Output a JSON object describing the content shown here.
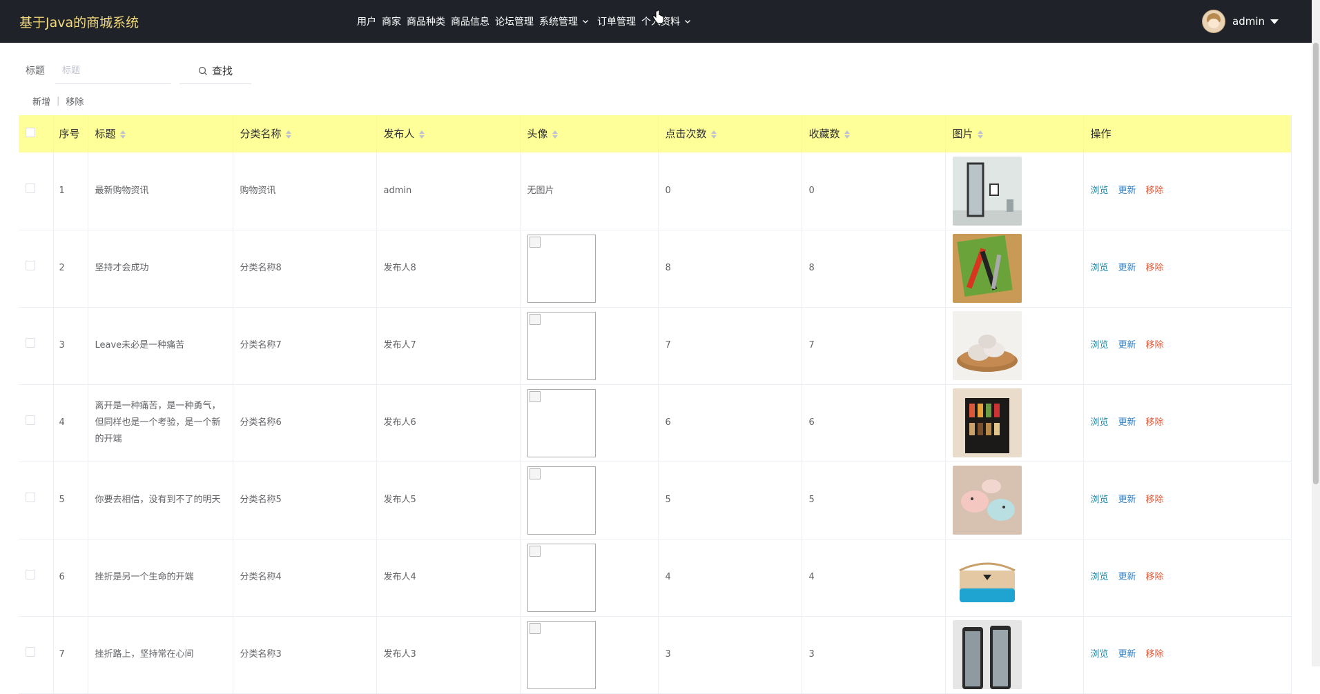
{
  "brand": "基于Java的商城系统",
  "nav": [
    {
      "label": "用户",
      "dropdown": false
    },
    {
      "label": "商家",
      "dropdown": false
    },
    {
      "label": "商品种类",
      "dropdown": false
    },
    {
      "label": "商品信息",
      "dropdown": false
    },
    {
      "label": "论坛管理",
      "dropdown": false
    },
    {
      "label": "系统管理",
      "dropdown": true
    },
    {
      "label": "订单管理",
      "dropdown": false
    },
    {
      "label": "个人资料",
      "dropdown": true
    }
  ],
  "user": {
    "name": "admin"
  },
  "search": {
    "label": "标题",
    "placeholder": "标题",
    "button": "查找"
  },
  "actions": {
    "add": "新增",
    "remove": "移除"
  },
  "table": {
    "columns": {
      "index": "序号",
      "title": "标题",
      "category": "分类名称",
      "publisher": "发布人",
      "avatar": "头像",
      "clicks": "点击次数",
      "favorites": "收藏数",
      "picture": "图片",
      "operations": "操作"
    },
    "no_image_text": "无图片",
    "op_labels": {
      "view": "浏览",
      "update": "更新",
      "remove": "移除"
    },
    "rows": [
      {
        "index": "1",
        "title": "最新购物资讯",
        "category": "购物资讯",
        "publisher": "admin",
        "avatar": "none",
        "clicks": "0",
        "favorites": "0",
        "picture": "mirror"
      },
      {
        "index": "2",
        "title": "坚持才会成功",
        "category": "分类名称8",
        "publisher": "发布人8",
        "avatar": "broken",
        "clicks": "8",
        "favorites": "8",
        "picture": "knives"
      },
      {
        "index": "3",
        "title": "Leave未必是一种痛苦",
        "category": "分类名称7",
        "publisher": "发布人7",
        "avatar": "broken",
        "clicks": "7",
        "favorites": "7",
        "picture": "dumplings"
      },
      {
        "index": "4",
        "title": "离开是一种痛苦，是一种勇气，但同样也是一个考验，是一个新的开端",
        "category": "分类名称6",
        "publisher": "发布人6",
        "avatar": "broken",
        "clicks": "6",
        "favorites": "6",
        "picture": "spice-rack"
      },
      {
        "index": "5",
        "title": "你要去相信，没有到不了的明天",
        "category": "分类名称5",
        "publisher": "发布人5",
        "avatar": "broken",
        "clicks": "5",
        "favorites": "5",
        "picture": "toys"
      },
      {
        "index": "6",
        "title": "挫折是另一个生命的开端",
        "category": "分类名称4",
        "publisher": "发布人4",
        "avatar": "broken",
        "clicks": "4",
        "favorites": "4",
        "picture": "bag"
      },
      {
        "index": "7",
        "title": "挫折路上，坚持常在心间",
        "category": "分类名称3",
        "publisher": "发布人3",
        "avatar": "broken",
        "clicks": "3",
        "favorites": "3",
        "picture": "phones"
      }
    ]
  },
  "colors": {
    "topbar": "#1f2329",
    "brand": "#f3d97a",
    "header_row": "#ffff99",
    "view": "#1f8aa8",
    "update": "#2f7fc4",
    "remove": "#e85a3a"
  }
}
